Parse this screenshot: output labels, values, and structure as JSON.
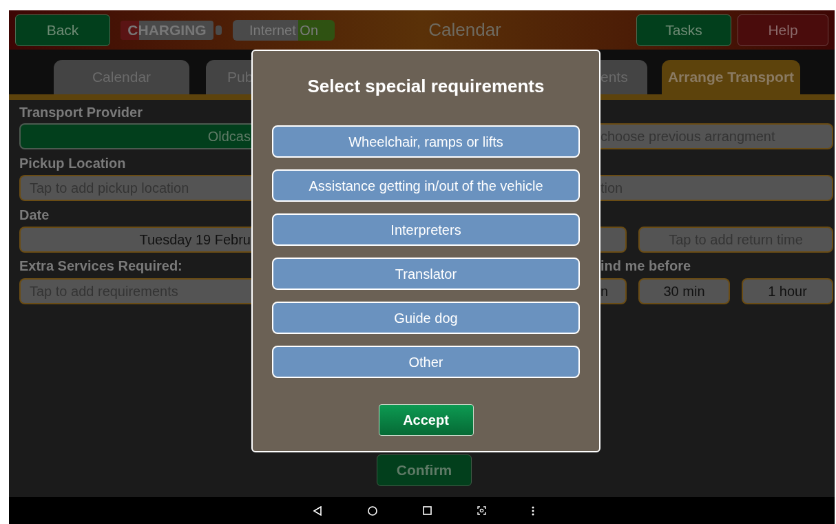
{
  "top_bar": {
    "back": "Back",
    "charging": "CHARGING",
    "internet": "Internet On",
    "title": "Calendar",
    "tasks": "Tasks",
    "help": "Help"
  },
  "tabs": [
    {
      "label": "Calendar",
      "selected": false
    },
    {
      "label": "Pub",
      "selected": false
    },
    {
      "label": "ents",
      "selected": false
    },
    {
      "label": "Arrange Transport",
      "selected": true
    }
  ],
  "form": {
    "transport_provider": {
      "label": "Transport Provider",
      "value": "Oldcas",
      "previous": "choose previous arrangment"
    },
    "pickup": {
      "label": "Pickup Location",
      "placeholder": "Tap to add pickup location",
      "destination_placeholder": "tion"
    },
    "date": {
      "label": "Date",
      "value": "Tuesday 19 Febru",
      "return_placeholder": "Tap to add return time"
    },
    "extra": {
      "label": "Extra Services Required:",
      "placeholder": "Tap to add requirements"
    },
    "remind": {
      "label": "ind me before",
      "options": [
        "n",
        "30 min",
        "1 hour"
      ]
    }
  },
  "confirm": "Confirm",
  "dialog": {
    "title": "Select special requirements",
    "options": [
      "Wheelchair, ramps or lifts",
      "Assistance getting in/out of the vehicle",
      "Interpreters",
      "Translator",
      "Guide dog",
      "Other"
    ],
    "accept": "Accept"
  }
}
